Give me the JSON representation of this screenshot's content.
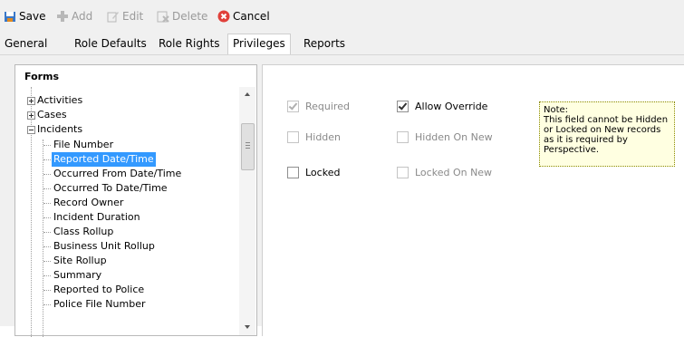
{
  "toolbar": {
    "save": "Save",
    "add": "Add",
    "edit": "Edit",
    "delete": "Delete",
    "cancel": "Cancel"
  },
  "tabs": [
    "General",
    "Role Defaults",
    "Role Rights",
    "Privileges",
    "Reports"
  ],
  "active_tab": "Privileges",
  "tree": {
    "title": "Forms",
    "nodes": {
      "activities": "Activities",
      "cases": "Cases",
      "incidents": "Incidents"
    },
    "incident_fields": [
      "File Number",
      "Reported Date/Time",
      "Occurred From Date/Time",
      "Occurred To Date/Time",
      "Record Owner",
      "Incident Duration",
      "Class Rollup",
      "Business Unit Rollup",
      "Site Rollup",
      "Summary",
      "Reported to Police",
      "Police File Number"
    ],
    "selected": "Reported Date/Time"
  },
  "privileges": {
    "required": {
      "label": "Required",
      "checked": true,
      "enabled": false
    },
    "allow_override": {
      "label": "Allow Override",
      "checked": true,
      "enabled": true
    },
    "hidden": {
      "label": "Hidden",
      "checked": false,
      "enabled": false
    },
    "hidden_on_new": {
      "label": "Hidden On New",
      "checked": false,
      "enabled": false
    },
    "locked": {
      "label": "Locked",
      "checked": false,
      "enabled": true
    },
    "locked_on_new": {
      "label": "Locked On New",
      "checked": false,
      "enabled": false
    }
  },
  "note": {
    "title": "Note:",
    "text": "This field cannot be Hidden or Locked on New records as it is required by Perspective."
  },
  "colors": {
    "selection": "#3399ff",
    "note_bg": "#ffffe1",
    "cancel_icon": "#e0403a"
  }
}
